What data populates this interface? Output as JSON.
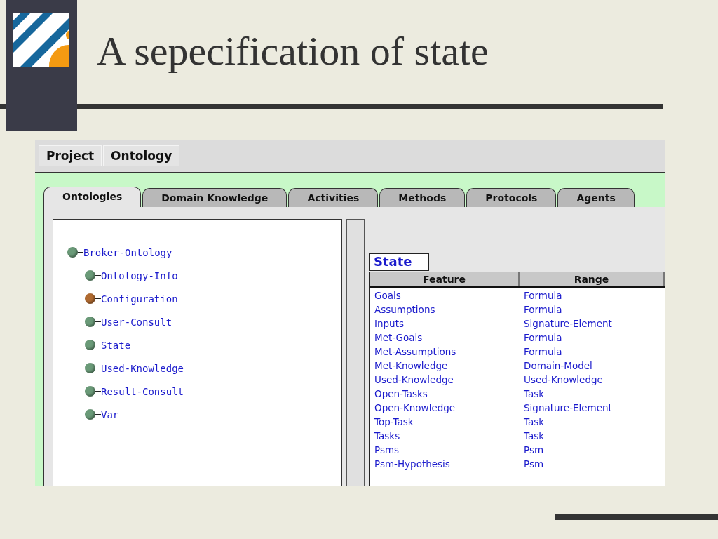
{
  "slide": {
    "title": "A sepecification of state"
  },
  "menu": [
    "Project",
    "Ontology"
  ],
  "tabs": [
    {
      "label": "Ontologies",
      "selected": true
    },
    {
      "label": "Domain Knowledge",
      "selected": false
    },
    {
      "label": "Activities",
      "selected": false
    },
    {
      "label": "Methods",
      "selected": false
    },
    {
      "label": "Protocols",
      "selected": false
    },
    {
      "label": "Agents",
      "selected": false
    }
  ],
  "tree": [
    {
      "label": "Broker-Ontology",
      "color": "#6a9a78",
      "children": [
        {
          "label": "Ontology-Info",
          "color": "#6a9a78"
        },
        {
          "label": "Configuration",
          "color": "#b06a30"
        },
        {
          "label": "User-Consult",
          "color": "#6a9a78"
        },
        {
          "label": "State",
          "color": "#6a9a78"
        },
        {
          "label": "Used-Knowledge",
          "color": "#6a9a78"
        },
        {
          "label": "Result-Consult",
          "color": "#6a9a78"
        },
        {
          "label": "Var",
          "color": "#6a9a78"
        }
      ]
    }
  ],
  "detail": {
    "title": "State",
    "columns": [
      "Feature",
      "Range"
    ],
    "rows": [
      [
        "Goals",
        "Formula"
      ],
      [
        "Assumptions",
        "Formula"
      ],
      [
        "Inputs",
        "Signature-Element"
      ],
      [
        "Met-Goals",
        "Formula"
      ],
      [
        "Met-Assumptions",
        "Formula"
      ],
      [
        "Met-Knowledge",
        "Domain-Model"
      ],
      [
        "Used-Knowledge",
        "Used-Knowledge"
      ],
      [
        "Open-Tasks",
        "Task"
      ],
      [
        "Open-Knowledge",
        "Signature-Element"
      ],
      [
        "Top-Task",
        "Task"
      ],
      [
        "Tasks",
        "Task"
      ],
      [
        "Psms",
        "Psm"
      ],
      [
        "Psm-Hypothesis",
        "Psm"
      ]
    ]
  }
}
